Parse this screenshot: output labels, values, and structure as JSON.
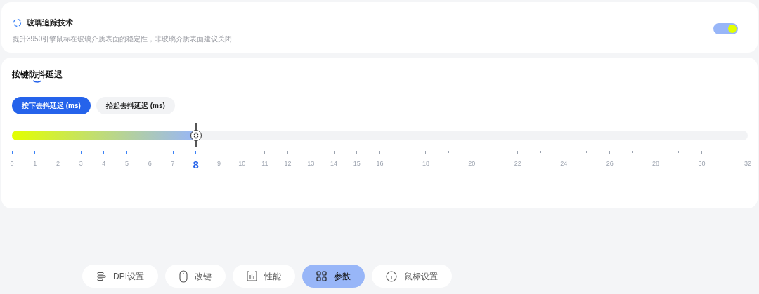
{
  "glass_tracking": {
    "title": "玻璃追踪技术",
    "description": "提升3950引擎鼠标在玻璃介质表面的稳定性，非玻璃介质表面建议关闭",
    "toggle": {
      "on": true
    }
  },
  "debounce": {
    "title": "按键防抖延迟",
    "tabs": [
      {
        "label": "按下去抖延迟 (ms)",
        "selected": true
      },
      {
        "label": "抬起去抖延迟 (ms)",
        "selected": false
      }
    ],
    "slider": {
      "level": 0.25
    },
    "ticks": [
      {
        "kind": "major",
        "label": "0"
      },
      {
        "kind": "major",
        "label": "1"
      },
      {
        "kind": "major",
        "label": "2"
      },
      {
        "kind": "major",
        "label": "3"
      },
      {
        "kind": "major",
        "label": "4"
      },
      {
        "kind": "major",
        "label": "5"
      },
      {
        "kind": "major",
        "label": "6"
      },
      {
        "kind": "major",
        "label": "7"
      },
      {
        "kind": "major",
        "label": "8"
      },
      {
        "kind": "major",
        "label": "9"
      },
      {
        "kind": "major",
        "label": "10"
      },
      {
        "kind": "major",
        "label": "11"
      },
      {
        "kind": "major",
        "label": "12"
      },
      {
        "kind": "major",
        "label": "13"
      },
      {
        "kind": "major",
        "label": "14"
      },
      {
        "kind": "major",
        "label": "15"
      },
      {
        "kind": "major",
        "label": "16"
      },
      {
        "kind": "minor"
      },
      {
        "kind": "major",
        "label": "18"
      },
      {
        "kind": "minor"
      },
      {
        "kind": "major",
        "label": "20"
      },
      {
        "kind": "minor"
      },
      {
        "kind": "major",
        "label": "22"
      },
      {
        "kind": "minor"
      },
      {
        "kind": "major",
        "label": "24"
      },
      {
        "kind": "minor"
      },
      {
        "kind": "major",
        "label": "26"
      },
      {
        "kind": "minor"
      },
      {
        "kind": "major",
        "label": "28"
      },
      {
        "kind": "minor"
      },
      {
        "kind": "major",
        "label": "30"
      },
      {
        "kind": "minor"
      },
      {
        "kind": "major",
        "label": "32"
      }
    ]
  },
  "nav": [
    {
      "kind": "bars",
      "label": "DPI设置",
      "selected": false
    },
    {
      "kind": "mouse",
      "label": "改键",
      "selected": false
    },
    {
      "kind": "chart",
      "label": "性能",
      "selected": false
    },
    {
      "kind": "grid",
      "label": "参数",
      "selected": true
    },
    {
      "kind": "info",
      "label": "鼠标设置",
      "selected": false
    }
  ]
}
